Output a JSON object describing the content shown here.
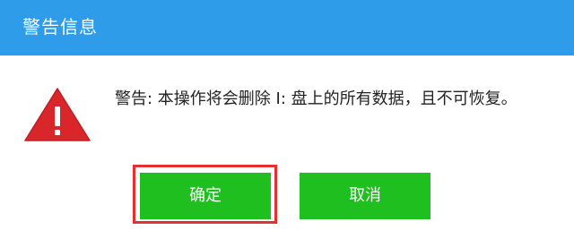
{
  "window": {
    "title": "警告信息"
  },
  "dialog": {
    "icon": "warning-triangle-icon",
    "message": "警告: 本操作将会删除 I: 盘上的所有数据，且不可恢复。"
  },
  "buttons": {
    "confirm_label": "确定",
    "cancel_label": "取消"
  },
  "colors": {
    "titlebar": "#2e9ce8",
    "button": "#1fbf1f",
    "warning_icon": "#d9262b",
    "highlight_box": "#e53030"
  }
}
